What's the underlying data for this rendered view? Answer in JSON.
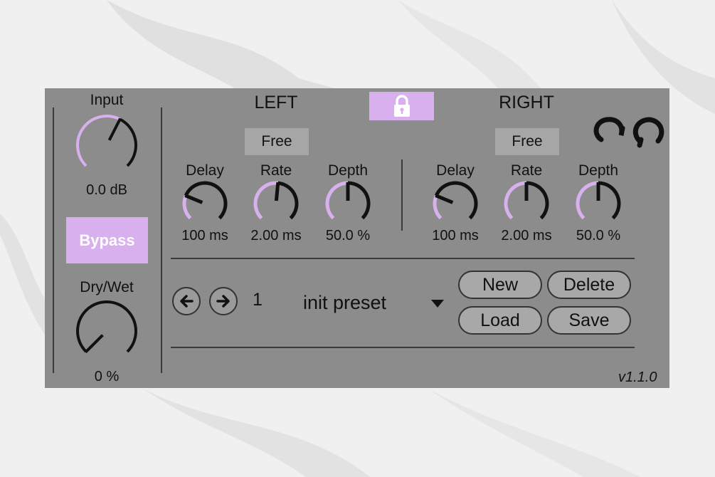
{
  "input": {
    "label": "Input",
    "value": "0.0 dB",
    "level": 0.6
  },
  "bypass": {
    "label": "Bypass"
  },
  "drywet": {
    "label": "Dry/Wet",
    "value": "0 %",
    "level": 0.0
  },
  "lock_icon": "lock-icon",
  "left": {
    "title": "LEFT",
    "mode": "Free",
    "delay": {
      "label": "Delay",
      "value": "100 ms",
      "level": 0.25
    },
    "rate": {
      "label": "Rate",
      "value": "2.00 ms",
      "level": 0.52
    },
    "depth": {
      "label": "Depth",
      "value": "50.0 %",
      "level": 0.5
    }
  },
  "right": {
    "title": "RIGHT",
    "mode": "Free",
    "delay": {
      "label": "Delay",
      "value": "100 ms",
      "level": 0.25
    },
    "rate": {
      "label": "Rate",
      "value": "2.00 ms",
      "level": 0.5
    },
    "depth": {
      "label": "Depth",
      "value": "50.0 %",
      "level": 0.5
    }
  },
  "preset": {
    "number": "1",
    "name": "init preset",
    "buttons": {
      "new": "New",
      "delete": "Delete",
      "load": "Load",
      "save": "Save"
    }
  },
  "version": "v1.1.0",
  "colors": {
    "accent": "#d9b0ee",
    "panel": "#8c8c8c",
    "dark": "#111111"
  }
}
